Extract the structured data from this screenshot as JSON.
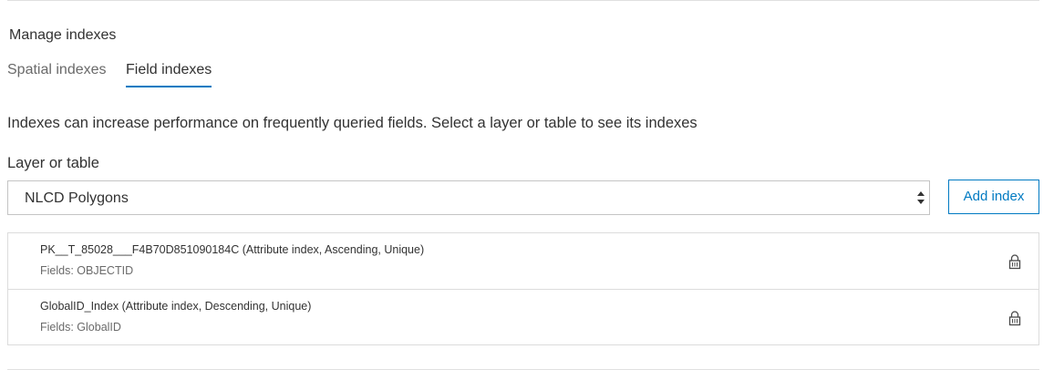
{
  "section": {
    "title": "Manage indexes"
  },
  "tabs": [
    {
      "label": "Spatial indexes",
      "active": false
    },
    {
      "label": "Field indexes",
      "active": true
    }
  ],
  "description": "Indexes can increase performance on frequently queried fields. Select a layer or table to see its indexes",
  "layer_select": {
    "label": "Layer or table",
    "value": "NLCD Polygons",
    "icon": "select-arrows-icon"
  },
  "add_button": {
    "label": "Add index"
  },
  "indexes": [
    {
      "name": "PK__T_85028___F4B70D851090184C (Attribute index, Ascending, Unique)",
      "fields": "Fields: OBJECTID",
      "icon": "lock-icon"
    },
    {
      "name": "GlobalID_Index (Attribute index, Descending, Unique)",
      "fields": "Fields: GlobalID",
      "icon": "lock-icon"
    }
  ],
  "colors": {
    "accent": "#007ac2",
    "text": "#323232",
    "muted": "#6a6a6a",
    "border": "#c4c4c4"
  }
}
